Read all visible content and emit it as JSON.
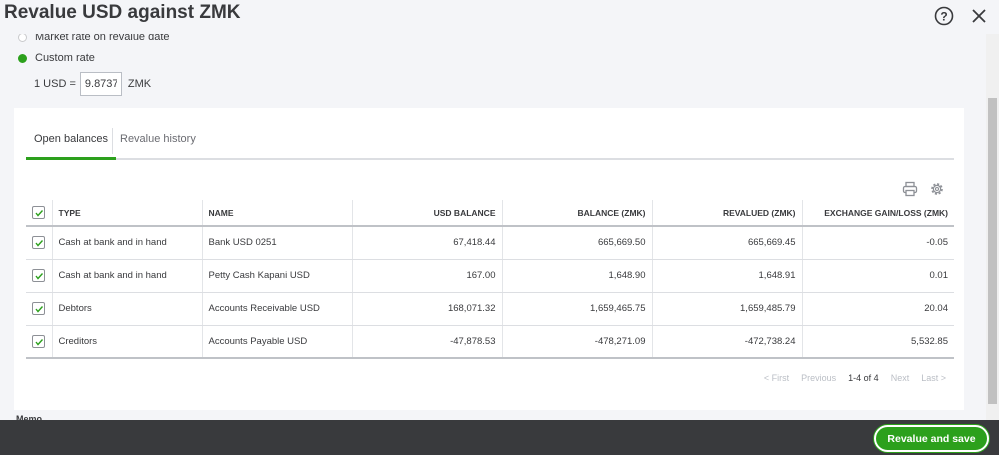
{
  "dialog": {
    "title": "Revalue USD against ZMK"
  },
  "rate_options": {
    "market_rate_label": "Market rate on revalue date",
    "custom_rate_label": "Custom rate",
    "rate_prefix": "1 USD =",
    "rate_value": "9.8737",
    "rate_suffix": "ZMK"
  },
  "tabs": {
    "open_balances": "Open balances",
    "revalue_history": "Revalue history"
  },
  "table": {
    "headers": {
      "type": "TYPE",
      "name": "NAME",
      "usd_balance": "USD BALANCE",
      "balance_zmk": "BALANCE (ZMK)",
      "revalued_zmk": "REVALUED (ZMK)",
      "exchange_gain_loss": "EXCHANGE GAIN/LOSS (ZMK)"
    },
    "rows": [
      {
        "type": "Cash at bank and in hand",
        "name": "Bank USD 0251",
        "usd_balance": "67,418.44",
        "balance_zmk": "665,669.50",
        "revalued_zmk": "665,669.45",
        "gain_loss": "-0.05"
      },
      {
        "type": "Cash at bank and in hand",
        "name": "Petty Cash Kapani USD",
        "usd_balance": "167.00",
        "balance_zmk": "1,648.90",
        "revalued_zmk": "1,648.91",
        "gain_loss": "0.01"
      },
      {
        "type": "Debtors",
        "name": "Accounts Receivable USD",
        "usd_balance": "168,071.32",
        "balance_zmk": "1,659,465.75",
        "revalued_zmk": "1,659,485.79",
        "gain_loss": "20.04"
      },
      {
        "type": "Creditors",
        "name": "Accounts Payable USD",
        "usd_balance": "-47,878.53",
        "balance_zmk": "-478,271.09",
        "revalued_zmk": "-472,738.24",
        "gain_loss": "5,532.85"
      }
    ]
  },
  "pager": {
    "first": "< First",
    "previous": "Previous",
    "range": "1-4 of 4",
    "next": "Next",
    "last": "Last >"
  },
  "memo_label": "Memo",
  "footer": {
    "save_label": "Revalue and save"
  },
  "colors": {
    "accent": "#2ca01c",
    "footer_bg": "#393a3d"
  }
}
